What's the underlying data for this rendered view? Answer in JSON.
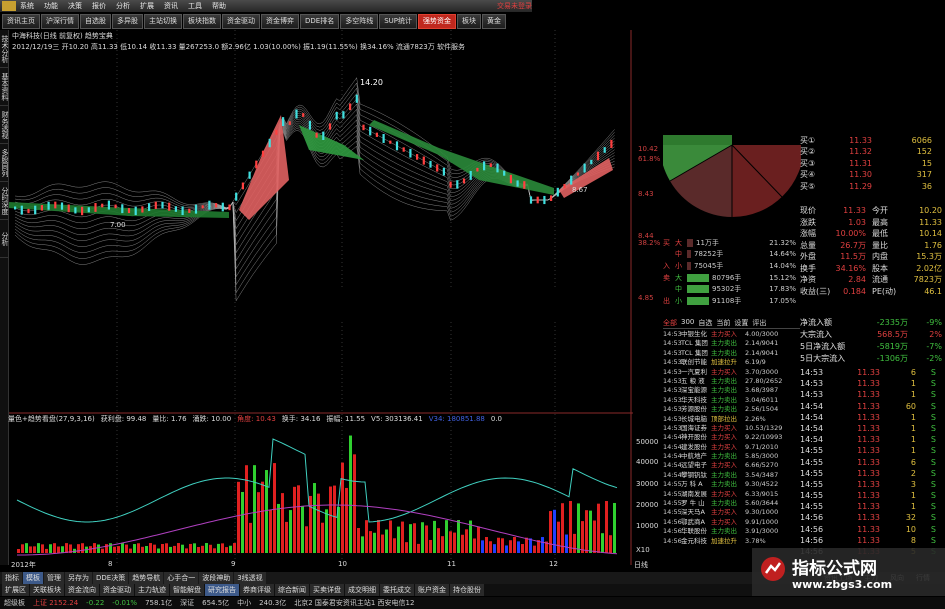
{
  "app": {
    "title": "交易未登录",
    "menu": [
      "系统",
      "功能",
      "决策",
      "报价",
      "分析",
      "扩展",
      "资讯",
      "工具",
      "帮助"
    ]
  },
  "tabs": [
    {
      "label": "资讯主页"
    },
    {
      "label": "沪深行情"
    },
    {
      "label": "自选股"
    },
    {
      "label": "多异股"
    },
    {
      "label": "主站切换"
    },
    {
      "label": "板块指数"
    },
    {
      "label": "资金驱动"
    },
    {
      "label": "资金博弈"
    },
    {
      "label": "DDE排名"
    },
    {
      "label": "多空阵线"
    },
    {
      "label": "SUP统计"
    },
    {
      "label": "强势资金",
      "active": true
    },
    {
      "label": "板块"
    },
    {
      "label": "黄金"
    }
  ],
  "left_buttons": [
    "技术分析",
    "基本资料",
    "财务透视",
    "多股同列",
    "分时深度",
    "分析"
  ],
  "stock_info": {
    "line1": "中海科技(日线 前复权) 趋势宝典",
    "line2": "2012/12/19三 开10.20 高11.33 低10.14 收11.33 量267253.0 额2.96亿 1.03(10.00%) 振1.19(11.55%) 换34.16% 流通7823万 软件服务"
  },
  "price_labels": {
    "high": "14.20",
    "low1": "7.00",
    "low2": "8.67"
  },
  "y_axis": [
    "10.42",
    "61.8%",
    "8.43",
    "8.44",
    "38.2%",
    "4.85"
  ],
  "indicator": {
    "name": "量色+趋势看盘(27,9,3,16)",
    "fields": [
      "获利盘: 99.48",
      "量比: 1.76",
      "涌跌: 10.00",
      "角度: 10.43",
      "换手: 34.16",
      "振幅: 11.55",
      "V5: 303136.41",
      "V34: 180851.88",
      "0.0"
    ]
  },
  "ind_y": [
    "50000",
    "40000",
    "30000",
    "20000",
    "10000",
    "X10"
  ],
  "date_axis": [
    "2012年",
    "8",
    "9",
    "10",
    "11",
    "12"
  ],
  "order_book": [
    {
      "k": "买①",
      "p": "11.33",
      "v": "6066"
    },
    {
      "k": "买②",
      "p": "11.32",
      "v": "152"
    },
    {
      "k": "买③",
      "p": "11.31",
      "v": "15"
    },
    {
      "k": "买④",
      "p": "11.30",
      "v": "317"
    },
    {
      "k": "买⑤",
      "p": "11.29",
      "v": "36"
    }
  ],
  "quote": [
    {
      "k": "现价",
      "v": "11.33",
      "k2": "今开",
      "v2": "10.20"
    },
    {
      "k": "涨跌",
      "v": "1.03",
      "k2": "最高",
      "v2": "11.33"
    },
    {
      "k": "涨幅",
      "v": "10.00%",
      "k2": "最低",
      "v2": "10.14"
    },
    {
      "k": "总量",
      "v": "26.7万",
      "k2": "量比",
      "v2": "1.76"
    },
    {
      "k": "外盘",
      "v": "11.5万",
      "k2": "内盘",
      "v2": "15.3万"
    },
    {
      "k": "换手",
      "v": "34.16%",
      "k2": "股本",
      "v2": "2.02亿"
    },
    {
      "k": "净资",
      "v": "2.84",
      "k2": "流通",
      "v2": "7823万"
    },
    {
      "k": "收益(三)",
      "v": "0.184",
      "k2": "PE(动)",
      "v2": "46.1"
    }
  ],
  "flow": [
    {
      "g": "买",
      "l": "大",
      "amt": "11万手",
      "pct": "21.32%",
      "c": "#5a2a2a",
      "w": 6
    },
    {
      "g": "",
      "l": "中",
      "amt": "78252手",
      "pct": "14.64%",
      "c": "#5a2a2a",
      "w": 4
    },
    {
      "g": "入",
      "l": "小",
      "amt": "75045手",
      "pct": "14.04%",
      "c": "#5a2a2a",
      "w": 4
    },
    {
      "g": "卖",
      "l": "大",
      "amt": "80796手",
      "pct": "15.12%",
      "c": "#40a040",
      "w": 22
    },
    {
      "g": "",
      "l": "中",
      "amt": "95302手",
      "pct": "17.83%",
      "c": "#40a040",
      "w": 22
    },
    {
      "g": "出",
      "l": "小",
      "amt": "91108手",
      "pct": "17.05%",
      "c": "#40a040",
      "w": 22
    }
  ],
  "trade_tabs": [
    "全部",
    "300",
    "自选",
    "当前",
    "设置",
    "评出"
  ],
  "trades": [
    {
      "t": "14:53",
      "n": "中银生化",
      "a": "主力买入",
      "p": "4.00/3000"
    },
    {
      "t": "14:53",
      "n": "TCL 集团",
      "a": "主力卖出",
      "p": "2.14/9041"
    },
    {
      "t": "14:53",
      "n": "TCL 集团",
      "a": "主力卖出",
      "p": "2.14/9041"
    },
    {
      "t": "14:53",
      "n": "联创节能",
      "a": "加速拉升",
      "p": "6.19/9"
    },
    {
      "t": "14:53",
      "n": "一汽夏利",
      "a": "主力买入",
      "p": "3.70/3000"
    },
    {
      "t": "14:53",
      "n": "五 粮 液",
      "a": "主力卖出",
      "p": "27.80/2652"
    },
    {
      "t": "14:53",
      "n": "深宝能源",
      "a": "主力卖出",
      "p": "3.68/3987"
    },
    {
      "t": "14:53",
      "n": "华天科技",
      "a": "主力卖出",
      "p": "3.04/6011"
    },
    {
      "t": "14:53",
      "n": "芳源股份",
      "a": "主力卖出",
      "p": "2.56/1504"
    },
    {
      "t": "14:53",
      "n": "长城电脑",
      "a": "顶部拉出",
      "p": "2.26%"
    },
    {
      "t": "14:53",
      "n": "国海证券",
      "a": "主力买入",
      "p": "10.53/1329"
    },
    {
      "t": "14:54",
      "n": "神开股份",
      "a": "主力买入",
      "p": "9.22/10993"
    },
    {
      "t": "14:54",
      "n": "建发股份",
      "a": "主力买入",
      "p": "9.71/2010"
    },
    {
      "t": "14:54",
      "n": "中航地产",
      "a": "主力卖出",
      "p": "5.85/3000"
    },
    {
      "t": "14:54",
      "n": "远望电子",
      "a": "主力买入",
      "p": "6.66/5270"
    },
    {
      "t": "14:54",
      "n": "攀钢钒钛",
      "a": "主力卖出",
      "p": "3.54/3487"
    },
    {
      "t": "14:55",
      "n": "万 科 A",
      "a": "主力卖出",
      "p": "9.30/4522"
    },
    {
      "t": "14:55",
      "n": "湖南发展",
      "a": "主力买入",
      "p": "6.33/9015"
    },
    {
      "t": "14:55",
      "n": "罗 牛 山",
      "a": "主力卖出",
      "p": "5.60/3644"
    },
    {
      "t": "14:55",
      "n": "深天马A",
      "a": "主力买入",
      "p": "9.30/1000"
    },
    {
      "t": "14:56",
      "n": "鄂武商A",
      "a": "主力买入",
      "p": "9.91/1000"
    },
    {
      "t": "14:56",
      "n": "华联股份",
      "a": "主力卖出",
      "p": "3.91/3000"
    },
    {
      "t": "14:56",
      "n": "金元科技",
      "a": "加速拉升",
      "p": "3.78%"
    }
  ],
  "fund": [
    {
      "k": "净流入额",
      "v": "-2335万",
      "p": "-9%"
    },
    {
      "k": "大宗流入",
      "v": "568.5万",
      "p": "2%"
    },
    {
      "k": "5日净流入额",
      "v": "-5819万",
      "p": "-7%"
    },
    {
      "k": "5日大宗流入",
      "v": "-1306万",
      "p": "-2%"
    }
  ],
  "ticks": [
    {
      "t": "14:53",
      "p": "11.33",
      "v": "6",
      "s": "S"
    },
    {
      "t": "14:53",
      "p": "11.33",
      "v": "1",
      "s": "S"
    },
    {
      "t": "14:53",
      "p": "11.33",
      "v": "1",
      "s": "S"
    },
    {
      "t": "14:54",
      "p": "11.33",
      "v": "60",
      "s": "S"
    },
    {
      "t": "14:54",
      "p": "11.33",
      "v": "1",
      "s": "S"
    },
    {
      "t": "14:54",
      "p": "11.33",
      "v": "1",
      "s": "S"
    },
    {
      "t": "14:54",
      "p": "11.33",
      "v": "1",
      "s": "S"
    },
    {
      "t": "14:55",
      "p": "11.33",
      "v": "1",
      "s": "S"
    },
    {
      "t": "14:55",
      "p": "11.33",
      "v": "6",
      "s": "S"
    },
    {
      "t": "14:55",
      "p": "11.33",
      "v": "2",
      "s": "S"
    },
    {
      "t": "14:55",
      "p": "11.33",
      "v": "3",
      "s": "S"
    },
    {
      "t": "14:55",
      "p": "11.33",
      "v": "1",
      "s": "S"
    },
    {
      "t": "14:55",
      "p": "11.33",
      "v": "1",
      "s": "S"
    },
    {
      "t": "14:56",
      "p": "11.33",
      "v": "32",
      "s": "S"
    },
    {
      "t": "14:56",
      "p": "11.33",
      "v": "10",
      "s": "S"
    },
    {
      "t": "14:56",
      "p": "11.33",
      "v": "8",
      "s": "S"
    },
    {
      "t": "14:56",
      "p": "11.33",
      "v": "5",
      "s": "S"
    }
  ],
  "bottom_tabs": [
    "指标",
    "模板",
    "管理",
    "另存为",
    "DDE决策",
    "趋势导航",
    "心手合一",
    "波段神助",
    "3线透视"
  ],
  "bottom_tabs2": [
    "扩展区",
    "关联板块",
    "资金流向",
    "资金驱动",
    "主力轨迹",
    "智能解盘",
    "研究报告",
    "券商评级",
    "综合新闻",
    "买卖详盘",
    "成交明细",
    "委托成交",
    "账户资金",
    "持仓股份"
  ],
  "status": [
    {
      "t": "超级板",
      "c": ""
    },
    {
      "t": "上证 2152.24",
      "c": "up"
    },
    {
      "t": "-0.22",
      "c": "dn"
    },
    {
      "t": "-0.01%",
      "c": "dn"
    },
    {
      "t": "758.1亿",
      "c": ""
    },
    {
      "t": "深证",
      "c": ""
    },
    {
      "t": "654.5亿",
      "c": ""
    },
    {
      "t": "中小",
      "c": ""
    },
    {
      "t": "240.3亿",
      "c": ""
    },
    {
      "t": "北京2 国泰君安资讯主站1 西安电信12",
      "c": ""
    }
  ],
  "right_tabs": [
    "资讯工场",
    "主力",
    "风向",
    "行情"
  ],
  "watermark": {
    "line1": "指标公式网",
    "line2": "www.zbgs3.com"
  }
}
